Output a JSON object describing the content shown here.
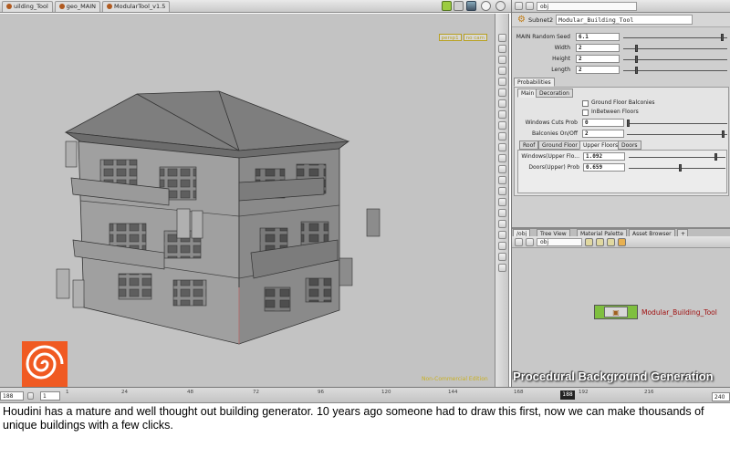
{
  "topbar": {
    "tabs": [
      {
        "label": "uilding_Tool"
      },
      {
        "label": "geo_MAIN"
      },
      {
        "label": "ModularTool_v1.5"
      }
    ]
  },
  "viewport": {
    "camera_labels": [
      "persp1",
      "no cam"
    ],
    "edition": "Non-Commercial Edition",
    "overlay_title": "Procedural Background Generation"
  },
  "params": {
    "path": "obj",
    "node_type": "Subnet2",
    "node_name": "Modular_Building_Tool",
    "seed_label": "MAIN Random Seed",
    "seed_value": "6.1",
    "width_label": "Width",
    "width_value": "2",
    "height_label": "Height",
    "height_value": "2",
    "length_label": "Length",
    "length_value": "2",
    "probabilities_tab": "Probabilities",
    "tabs_main": [
      "Main",
      "Decoration"
    ],
    "ground_balconies": "Ground Floor Balconies",
    "inbetween_floors": "InBetween Floors",
    "windows_cuts_label": "Windows Cuts Prob",
    "windows_cuts_value": "0",
    "balconies_label": "Balconies On/Off",
    "balconies_value": "2",
    "tabs_floor": [
      "Roof",
      "Ground Floor",
      "Upper Floors",
      "Doors"
    ],
    "windows_upper_label": "Windows(Upper Flo...",
    "windows_upper_value": "1.092",
    "doors_upper_label": "Doors(Upper) Prob",
    "doors_upper_value": "0.659"
  },
  "network": {
    "tabs": [
      "/obj",
      "Tree View",
      "Material Palette",
      "Asset Browser"
    ],
    "path": "obj",
    "node_label": "Modular_Building_Tool"
  },
  "timeline": {
    "start_field": "188",
    "step_field": "1",
    "ticks": [
      "24",
      "48",
      "72",
      "96",
      "120",
      "144",
      "168",
      "192",
      "216"
    ],
    "first_tick": "1",
    "current_frame": "188",
    "end_field": "240"
  },
  "caption": "Houdini has a mature and well thought out building generator. 10 years ago someone had to draw this first, now we can make thousands of unique buildings with a few clicks.",
  "colors": {
    "houdini_orange": "#f05a22",
    "node_green": "#7fbf3f",
    "edition_yellow": "#c8b020",
    "node_label_red": "#a01010"
  }
}
